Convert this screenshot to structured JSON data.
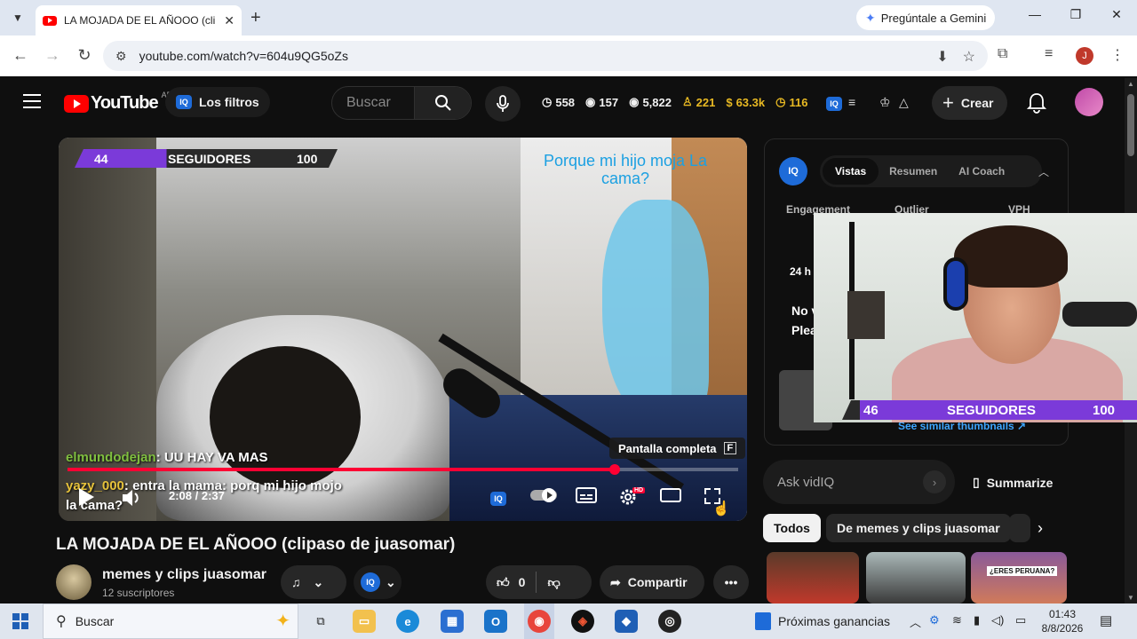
{
  "browser": {
    "tab_title": "LA MOJADA DE EL AÑOOO (clip",
    "gemini_label": "Pregúntale a Gemini",
    "url": "youtube.com/watch?v=604u9QG5oZs",
    "profile_initial": "J"
  },
  "youtube": {
    "logo_text": "YouTube",
    "country_code": "AR",
    "filters_label": "Los filtros",
    "search_placeholder": "Buscar",
    "stats": [
      "558",
      "157",
      "5,822",
      "221",
      "63.3k",
      "116"
    ],
    "create_label": "Crear"
  },
  "video": {
    "follower_bar": {
      "current": "44",
      "label": "SEGUIDORES",
      "goal": "100"
    },
    "caption": "Porque mi hijo moja La cama?",
    "chat": [
      {
        "user": "elmundodejan",
        "text": ": UU HAY VA MAS"
      },
      {
        "user": "yazy_000",
        "text": ": entra la mama: porq mi hijo mojo la cama?"
      }
    ],
    "tooltip": "Pantalla completa",
    "tooltip_key": "F",
    "time": "2:08 / 2:37",
    "progress_fraction": 0.8153,
    "hd_badge": "HD",
    "title": "LA MOJADA DE EL AÑOOO (clipaso de juasomar)"
  },
  "channel": {
    "name": "memes y clips juasomar",
    "subscribers": "12 suscriptores",
    "likes": "0",
    "share_label": "Compartir"
  },
  "vidiq": {
    "logo": "IQ",
    "tabs": [
      "Vistas",
      "Resumen",
      "AI Coach"
    ],
    "metrics": [
      "Engagement",
      "Outlier",
      "VPH"
    ],
    "period": "24 h",
    "notice_line1": "No v",
    "notice_line2": "Plea",
    "similar_link": "See similar thumbnails ↗",
    "ask_placeholder": "Ask vidIQ",
    "summarize_label": "Summarize"
  },
  "webcam_bar": {
    "current": "46",
    "label": "SEGUIDORES",
    "goal": "100"
  },
  "chips": [
    "Todos",
    "De memes y clips juasomar"
  ],
  "thumb_tag": "¿ERES PERUANA?",
  "taskbar": {
    "search_placeholder": "Buscar",
    "weather": "Próximas ganancias",
    "time": "01:43",
    "date": "8/8/2026"
  }
}
